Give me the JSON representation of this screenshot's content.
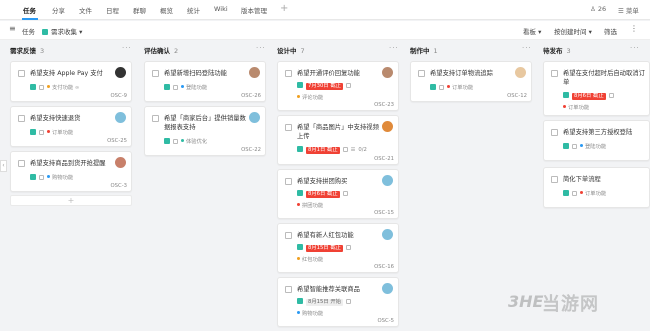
{
  "nav": {
    "tabs": [
      "任务",
      "分享",
      "文件",
      "日程",
      "群聊",
      "概览",
      "统计",
      "Wiki",
      "版本管理"
    ],
    "active": 0,
    "member_count": "26",
    "menu_label": "菜单"
  },
  "toolbar": {
    "task_label": "任务",
    "filter_label": "需求收集",
    "view_label": "看板",
    "sort_label": "按创建时间",
    "filter_btn": "筛选"
  },
  "columns": [
    {
      "title": "需求反馈",
      "count": "3"
    },
    {
      "title": "评估确认",
      "count": "2"
    },
    {
      "title": "设计中",
      "count": "7"
    },
    {
      "title": "制作中",
      "count": "1"
    },
    {
      "title": "待发布",
      "count": "3"
    }
  ],
  "cards": [
    {
      "title": "希望支持 Apple Pay 支付",
      "tag": "支付功能",
      "tag_color": "#f0a020",
      "id": "OSC-9"
    },
    {
      "title": "希望支持快速退货",
      "tag": "订单功能",
      "tag_color": "#f04134",
      "id": "OSC-25"
    },
    {
      "title": "希望支持商品到货开抢提醒",
      "tag": "购物功能",
      "tag_color": "#2b9af3",
      "id": "OSC-3"
    },
    {
      "title": "希望新增扫码登陆功能",
      "tag": "登陆功能",
      "tag_color": "#2b9af3",
      "id": "OSC-26"
    },
    {
      "title": "希望「商家后台」提供销量数据报表支持",
      "tag": "体验优化",
      "tag_color": "#2fbba4",
      "id": "OSC-22"
    },
    {
      "title": "希望开通评价回复功能",
      "badge": "7月30日 截止",
      "tag": "评论功能",
      "tag_color": "#f0a020",
      "id": "OSC-23"
    },
    {
      "title": "希望「商品图片」中支持视频上传",
      "badge": "8月1日 截止",
      "subtasks": "0/2",
      "id": "OSC-21"
    },
    {
      "title": "希望支持拼团购买",
      "badge": "8月6日 截止",
      "tag": "拼团功能",
      "tag_color": "#f04134",
      "id": "OSC-15"
    },
    {
      "title": "希望有新人红包功能",
      "badge": "8月15日 截止",
      "tag": "红包功能",
      "tag_color": "#f0a020",
      "id": "OSC-16"
    },
    {
      "title": "希望智能推荐关联商品",
      "badge_gray": "8月15日 开始",
      "tag": "购物功能",
      "tag_color": "#2b9af3",
      "id": "OSC-5"
    },
    {
      "title": "希望支持订单物流追踪",
      "tag": "订单功能",
      "tag_color": "#f04134",
      "id": "OSC-12"
    },
    {
      "title": "希望在支付超时后自动取消订单",
      "badge": "8月6日 截止",
      "tag": "订单功能",
      "tag_color": "#f04134",
      "id": ""
    },
    {
      "title": "希望支持第三方授权登陆",
      "tag": "登陆功能",
      "tag_color": "#2b9af3",
      "id": ""
    },
    {
      "title": "简化下单流程",
      "tag": "订单功能",
      "tag_color": "#f04134",
      "id": ""
    }
  ],
  "watermark": "当游网",
  "watermark_logo": "3HE"
}
